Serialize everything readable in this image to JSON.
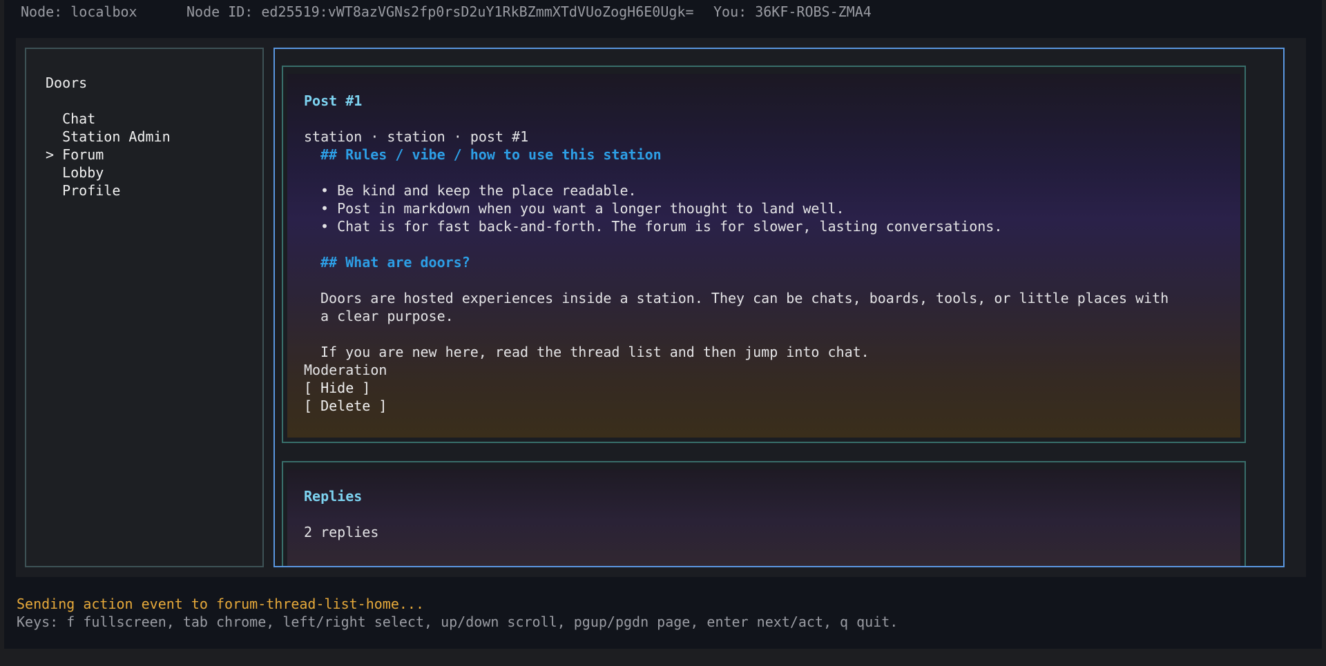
{
  "header": {
    "node": "Node: localbox",
    "node_id": "Node ID: ed25519:vWT8azVGNs2fp0rsD2uY1RkBZmmXTdVUoZogH6E0Ugk=",
    "you": "You: 36KF-ROBS-ZMA4"
  },
  "sidebar": {
    "title": "Doors",
    "items": [
      {
        "marker": "  ",
        "label": "Chat"
      },
      {
        "marker": "  ",
        "label": "Station Admin"
      },
      {
        "marker": "> ",
        "label": "Forum"
      },
      {
        "marker": "  ",
        "label": "Lobby"
      },
      {
        "marker": "  ",
        "label": "Profile"
      }
    ]
  },
  "post": {
    "title": "Post #1",
    "meta": "station · station · post #1",
    "h1": "## Rules / vibe / how to use this station",
    "bullets": [
      "• Be kind and keep the place readable.",
      "• Post in markdown when you want a longer thought to land well.",
      "• Chat is for fast back-and-forth. The forum is for slower, lasting conversations."
    ],
    "h2": "## What are doors?",
    "para1_line1": "Doors are hosted experiences inside a station. They can be chats, boards, tools, or little places with",
    "para1_line2": "a clear purpose.",
    "para2": "If you are new here, read the thread list and then jump into chat.",
    "moderation_label": "Moderation",
    "hide_label": "[ Hide ]",
    "delete_label": "[ Delete ]"
  },
  "replies": {
    "title": "Replies",
    "count": "2 replies"
  },
  "status": {
    "message": "Sending action event to forum-thread-list-home...",
    "keys": "Keys: f fullscreen, tab chrome, left/right select, up/down scroll, pgup/pgdn page, enter next/act, q quit."
  },
  "colors": {
    "accent_border": "#5a97e0",
    "panel_border": "#386e6a",
    "heading": "#7dd3f0",
    "md_heading": "#2d9fe6",
    "status": "#e6a93a"
  }
}
